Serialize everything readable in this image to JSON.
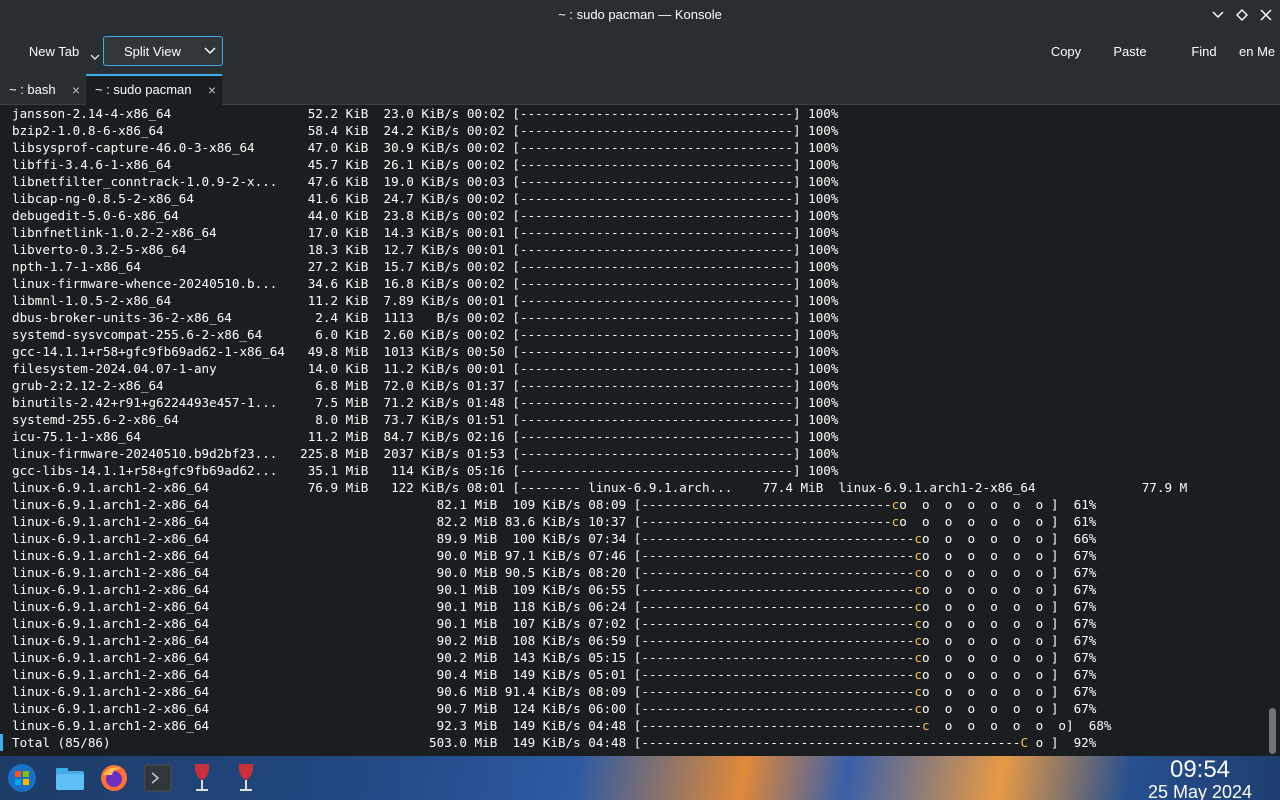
{
  "window": {
    "title": "~ : sudo pacman — Konsole"
  },
  "toolbar": {
    "new_tab": "New Tab",
    "split_view": "Split View",
    "copy": "Copy",
    "paste": "Paste",
    "find": "Find",
    "menu": "en Me"
  },
  "tabs": [
    {
      "label": "~ : bash"
    },
    {
      "label": "~ : sudo pacman"
    }
  ],
  "terminal": {
    "lines": [
      "jansson-2.14-4-x86_64                  52.2 KiB  23.0 KiB/s 00:02 [------------------------------------] 100%",
      "bzip2-1.0.8-6-x86_64                   58.4 KiB  24.2 KiB/s 00:02 [------------------------------------] 100%",
      "libsysprof-capture-46.0-3-x86_64       47.0 KiB  30.9 KiB/s 00:02 [------------------------------------] 100%",
      "libffi-3.4.6-1-x86_64                  45.7 KiB  26.1 KiB/s 00:02 [------------------------------------] 100%",
      "libnetfilter_conntrack-1.0.9-2-x...    47.6 KiB  19.0 KiB/s 00:03 [------------------------------------] 100%",
      "libcap-ng-0.8.5-2-x86_64               41.6 KiB  24.7 KiB/s 00:02 [------------------------------------] 100%",
      "debugedit-5.0-6-x86_64                 44.0 KiB  23.8 KiB/s 00:02 [------------------------------------] 100%",
      "libnfnetlink-1.0.2-2-x86_64            17.0 KiB  14.3 KiB/s 00:01 [------------------------------------] 100%",
      "libverto-0.3.2-5-x86_64                18.3 KiB  12.7 KiB/s 00:01 [------------------------------------] 100%",
      "npth-1.7-1-x86_64                      27.2 KiB  15.7 KiB/s 00:02 [------------------------------------] 100%",
      "linux-firmware-whence-20240510.b...    34.6 KiB  16.8 KiB/s 00:02 [------------------------------------] 100%",
      "libmnl-1.0.5-2-x86_64                  11.2 KiB  7.89 KiB/s 00:01 [------------------------------------] 100%",
      "dbus-broker-units-36-2-x86_64           2.4 KiB  1113   B/s 00:02 [------------------------------------] 100%",
      "systemd-sysvcompat-255.6-2-x86_64       6.0 KiB  2.60 KiB/s 00:02 [------------------------------------] 100%",
      "gcc-14.1.1+r58+gfc9fb69ad62-1-x86_64   49.8 MiB  1013 KiB/s 00:50 [------------------------------------] 100%",
      "filesystem-2024.04.07-1-any            14.0 KiB  11.2 KiB/s 00:01 [------------------------------------] 100%",
      "grub-2:2.12-2-x86_64                    6.8 MiB  72.0 KiB/s 01:37 [------------------------------------] 100%",
      "binutils-2.42+r91+g6224493e457-1...     7.5 MiB  71.2 KiB/s 01:48 [------------------------------------] 100%",
      "systemd-255.6-2-x86_64                  8.0 MiB  73.7 KiB/s 01:51 [------------------------------------] 100%",
      "icu-75.1-1-x86_64                      11.2 MiB  84.7 KiB/s 02:16 [------------------------------------] 100%",
      "linux-firmware-20240510.b9d2bf23...   225.8 MiB  2037 KiB/s 01:53 [------------------------------------] 100%",
      "gcc-libs-14.1.1+r58+gfc9fb69ad62...    35.1 MiB   114 KiB/s 05:16 [------------------------------------] 100%",
      "linux-6.9.1.arch1-2-x86_64             76.9 MiB   122 KiB/s 08:01 [-------- linux-6.9.1.arch...    77.4 MiB  linux-6.9.1.arch1-2-x86_64              77.9 M"
    ],
    "progress_lines": [
      {
        "name": "linux-6.9.1.arch1-2-x86_64",
        "size": "82.1 MiB",
        "speed": " 109 KiB/s",
        "eta": "08:09",
        "dashes": 33,
        "c": "c",
        "tail": "o  o  o  o  o  o  o ",
        "pct": " 61%"
      },
      {
        "name": "linux-6.9.1.arch1-2-x86_64",
        "size": "82.2 MiB",
        "speed": "83.6 KiB/s",
        "eta": "10:37",
        "dashes": 33,
        "c": "c",
        "tail": "o  o  o  o  o  o  o ",
        "pct": " 61%"
      },
      {
        "name": "linux-6.9.1.arch1-2-x86_64",
        "size": "89.9 MiB",
        "speed": " 100 KiB/s",
        "eta": "07:34",
        "dashes": 36,
        "c": "c",
        "tail": "o  o  o  o  o  o ",
        "pct": " 66%"
      },
      {
        "name": "linux-6.9.1.arch1-2-x86_64",
        "size": "90.0 MiB",
        "speed": "97.1 KiB/s",
        "eta": "07:46",
        "dashes": 36,
        "c": "c",
        "tail": "o  o  o  o  o  o ",
        "pct": " 67%"
      },
      {
        "name": "linux-6.9.1.arch1-2-x86_64",
        "size": "90.0 MiB",
        "speed": "90.5 KiB/s",
        "eta": "08:20",
        "dashes": 36,
        "c": "c",
        "tail": "o  o  o  o  o  o ",
        "pct": " 67%"
      },
      {
        "name": "linux-6.9.1.arch1-2-x86_64",
        "size": "90.1 MiB",
        "speed": " 109 KiB/s",
        "eta": "06:55",
        "dashes": 36,
        "c": "c",
        "tail": "o  o  o  o  o  o ",
        "pct": " 67%"
      },
      {
        "name": "linux-6.9.1.arch1-2-x86_64",
        "size": "90.1 MiB",
        "speed": " 118 KiB/s",
        "eta": "06:24",
        "dashes": 36,
        "c": "c",
        "tail": "o  o  o  o  o  o ",
        "pct": " 67%"
      },
      {
        "name": "linux-6.9.1.arch1-2-x86_64",
        "size": "90.1 MiB",
        "speed": " 107 KiB/s",
        "eta": "07:02",
        "dashes": 36,
        "c": "c",
        "tail": "o  o  o  o  o  o ",
        "pct": " 67%"
      },
      {
        "name": "linux-6.9.1.arch1-2-x86_64",
        "size": "90.2 MiB",
        "speed": " 108 KiB/s",
        "eta": "06:59",
        "dashes": 36,
        "c": "c",
        "tail": "o  o  o  o  o  o ",
        "pct": " 67%"
      },
      {
        "name": "linux-6.9.1.arch1-2-x86_64",
        "size": "90.2 MiB",
        "speed": " 143 KiB/s",
        "eta": "05:15",
        "dashes": 36,
        "c": "c",
        "tail": "o  o  o  o  o  o ",
        "pct": " 67%"
      },
      {
        "name": "linux-6.9.1.arch1-2-x86_64",
        "size": "90.4 MiB",
        "speed": " 149 KiB/s",
        "eta": "05:01",
        "dashes": 36,
        "c": "c",
        "tail": "o  o  o  o  o  o ",
        "pct": " 67%"
      },
      {
        "name": "linux-6.9.1.arch1-2-x86_64",
        "size": "90.6 MiB",
        "speed": "91.4 KiB/s",
        "eta": "08:09",
        "dashes": 36,
        "c": "c",
        "tail": "o  o  o  o  o  o ",
        "pct": " 67%"
      },
      {
        "name": "linux-6.9.1.arch1-2-x86_64",
        "size": "90.7 MiB",
        "speed": " 124 KiB/s",
        "eta": "06:00",
        "dashes": 36,
        "c": "c",
        "tail": "o  o  o  o  o  o ",
        "pct": " 67%"
      },
      {
        "name": "linux-6.9.1.arch1-2-x86_64",
        "size": "92.3 MiB",
        "speed": " 149 KiB/s",
        "eta": "04:48",
        "dashes": 37,
        "c": "c",
        "tail": "  o  o  o  o  o  o",
        "pct": " 68%"
      }
    ],
    "total_line": {
      "name": "Total (85/86)",
      "size": "503.0 MiB",
      "speed": " 149 KiB/s",
      "eta": "04:48",
      "dashes": 50,
      "c": "C",
      "tail": " o ",
      "pct": " 92%"
    }
  },
  "taskbar": {
    "time": "09:54",
    "date": "25 May 2024",
    "icons": [
      "start-menu-icon",
      "file-manager-icon",
      "firefox-icon",
      "terminal-icon",
      "wine-icon",
      "wine-icon"
    ]
  }
}
